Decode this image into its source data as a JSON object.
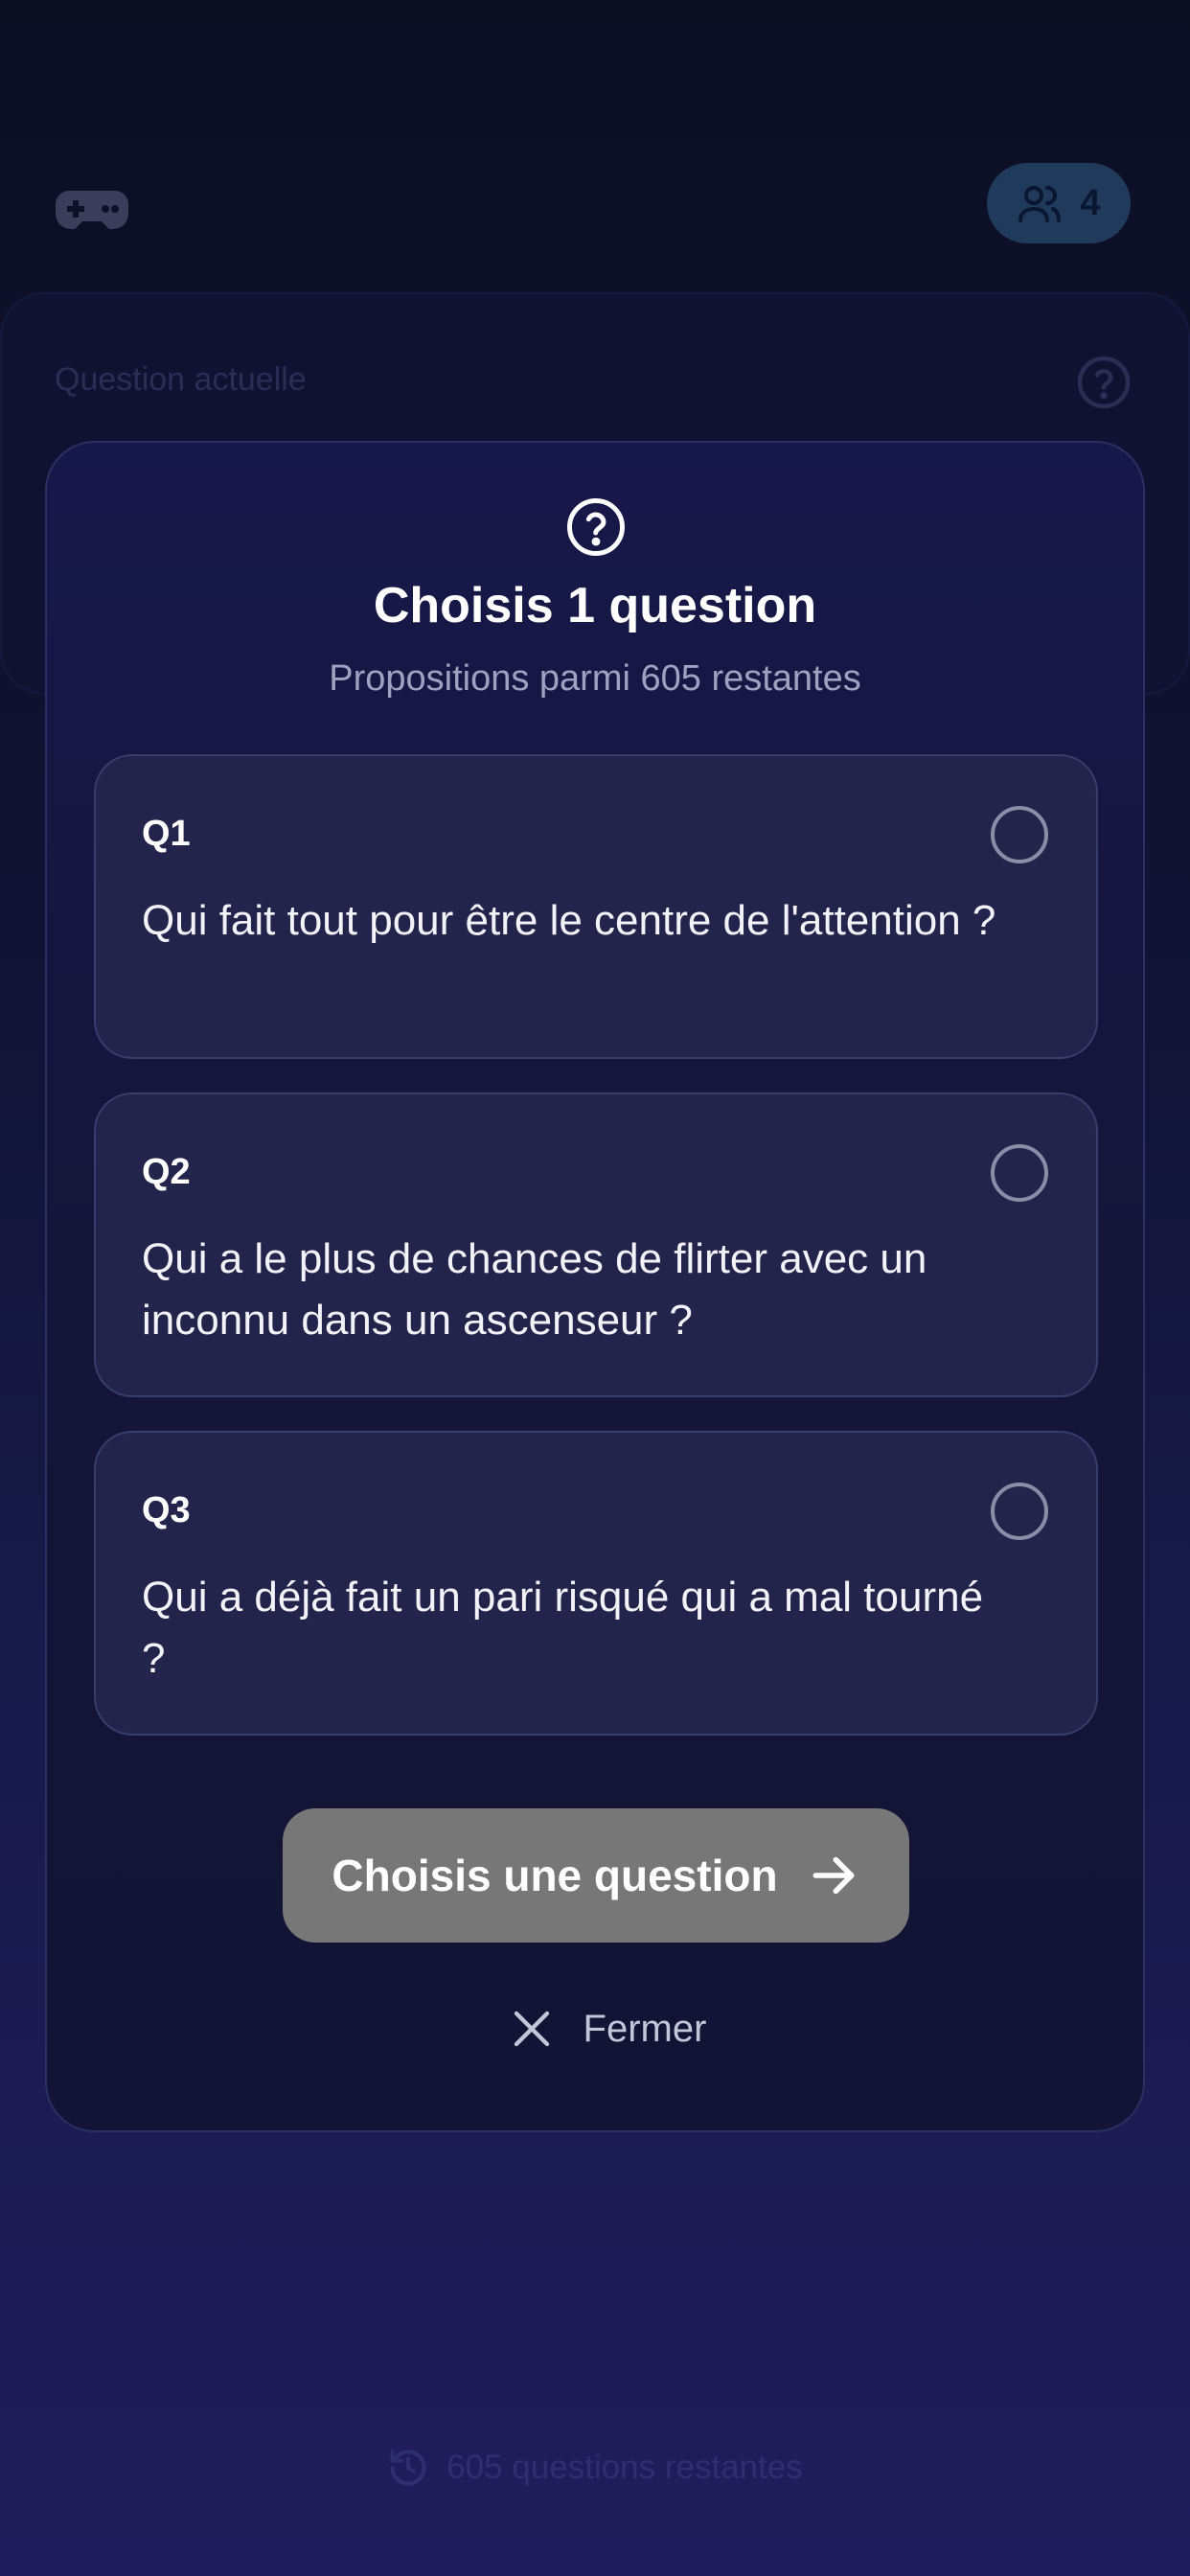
{
  "header": {
    "game_icon": "gamepad-icon",
    "players_icon": "users-icon",
    "players_count": "4"
  },
  "current_question": {
    "label": "Question actuelle",
    "help_icon": "question-circle-icon"
  },
  "footer": {
    "icon": "history-icon",
    "remaining_text": "605 questions restantes"
  },
  "modal": {
    "icon": "question-circle-icon",
    "title": "Choisis 1 question",
    "subtitle": "Propositions parmi 605 restantes",
    "options": [
      {
        "tag": "Q1",
        "text": "Qui fait tout pour être le centre de l'attention ?",
        "selected": false
      },
      {
        "tag": "Q2",
        "text": "Qui a le plus de chances de flirter avec un inconnu dans un ascenseur ?",
        "selected": false
      },
      {
        "tag": "Q3",
        "text": "Qui a déjà fait un pari risqué qui a mal tourné ?",
        "selected": false
      }
    ],
    "confirm_label": "Choisis une question",
    "confirm_icon": "arrow-right-icon",
    "close_label": "Fermer",
    "close_icon": "close-icon"
  },
  "colors": {
    "background_top": "#0c0e22",
    "background_bottom": "#201d5c",
    "modal_bg": "#141538",
    "card_bg": "#22244b",
    "button_disabled": "#777777"
  }
}
